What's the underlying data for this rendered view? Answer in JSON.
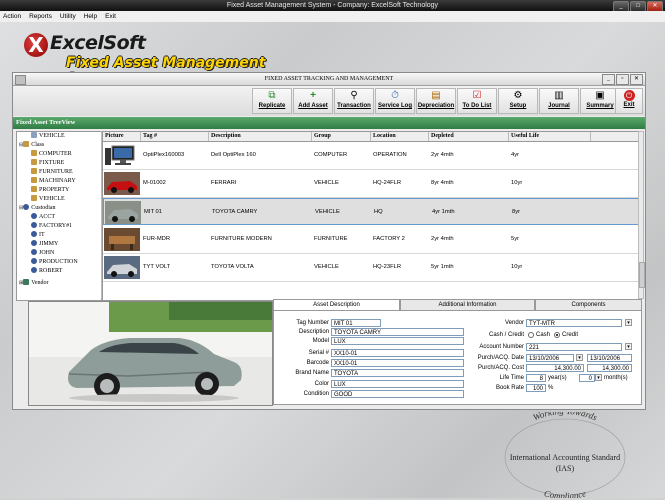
{
  "window_title": "Fixed Asset Management System - Company: ExcelSoft Technology",
  "menu": [
    "Action",
    "Reports",
    "Utility",
    "Help",
    "Exit"
  ],
  "logo": {
    "name": "ExcelSoft",
    "subtitle": "Fixed Asset Management System"
  },
  "main_window": {
    "title": "FIXED ASSET TRACKING AND MANAGEMENT"
  },
  "toolbar": [
    {
      "label": "Replicate",
      "icon": "replicate-icon"
    },
    {
      "label": "Add Asset",
      "icon": "add-asset-icon"
    },
    {
      "label": "Transaction",
      "icon": "transaction-icon"
    },
    {
      "label": "Service Log",
      "icon": "service-log-icon"
    },
    {
      "label": "Depreciation",
      "icon": "depreciation-icon"
    },
    {
      "label": "To Do List",
      "icon": "todo-list-icon"
    },
    {
      "label": "Setup",
      "icon": "setup-icon"
    },
    {
      "label": "Journal",
      "icon": "journal-icon"
    },
    {
      "label": "Summary",
      "icon": "summary-icon"
    },
    {
      "label": "Exit",
      "icon": "exit-icon"
    }
  ],
  "tree": {
    "title": "Fixed Asset TreeView",
    "items": [
      {
        "label": "VEHICLE",
        "level": 2
      },
      {
        "label": "Class",
        "level": 1
      },
      {
        "label": "COMPUTER",
        "level": 2
      },
      {
        "label": "FIXTURE",
        "level": 2
      },
      {
        "label": "FURNITURE",
        "level": 2
      },
      {
        "label": "MACHINARY",
        "level": 2
      },
      {
        "label": "PROPERTY",
        "level": 2
      },
      {
        "label": "VEHICLE",
        "level": 2
      },
      {
        "label": "Custodian",
        "level": 1
      },
      {
        "label": "ACCT",
        "level": 2
      },
      {
        "label": "FACTORY#1",
        "level": 2
      },
      {
        "label": "IT",
        "level": 2
      },
      {
        "label": "JIMMY",
        "level": 2
      },
      {
        "label": "JOHN",
        "level": 2
      },
      {
        "label": "PRODUCTION",
        "level": 2
      },
      {
        "label": "ROBERT",
        "level": 2
      },
      {
        "label": "Vendor",
        "level": 1
      }
    ]
  },
  "grid": {
    "columns": [
      "Picture",
      "Tag #",
      "Description",
      "Group",
      "Location",
      "Depleted",
      "Useful Life"
    ],
    "rows": [
      {
        "tag": "OptiPlex160003",
        "description": "Dell OptiPlex 160",
        "group": "COMPUTER",
        "location": "OPERATION",
        "depleted": "2yr 4mth",
        "useful_life": "4yr",
        "pic": "computer"
      },
      {
        "tag": "M-01002",
        "description": "FERRARI",
        "group": "VEHICLE",
        "location": "HQ-24FLR",
        "depleted": "8yr 4mth",
        "useful_life": "10yr",
        "pic": "redcar"
      },
      {
        "tag": "MIT 01",
        "description": "TOYOTA CAMRY",
        "group": "VEHICLE",
        "location": "HQ",
        "depleted": "4yr 1mth",
        "useful_life": "8yr",
        "pic": "graycar"
      },
      {
        "tag": "FUR-MDR",
        "description": "FURNITURE MODERN",
        "group": "FURNITURE",
        "location": "FACTORY 2",
        "depleted": "2yr 4mth",
        "useful_life": "5yr",
        "pic": "furniture"
      },
      {
        "tag": "TYT VOLT",
        "description": "TOYOTA VOLTA",
        "group": "VEHICLE",
        "location": "HQ-23FLR",
        "depleted": "5yr 1mth",
        "useful_life": "10yr",
        "pic": "silvercar"
      }
    ],
    "selected_row": 2
  },
  "tabs": [
    "Asset Description",
    "Additional Information",
    "Components"
  ],
  "active_tab": 0,
  "asset_description": {
    "tag_number_label": "Tag Number",
    "tag_number": "MIT 01",
    "description_label": "Description",
    "description": "TOYOTA CAMRY",
    "model_label": "Model",
    "model": "LUX",
    "serial_label": "Serial #",
    "serial": "XX10-01",
    "barcode_label": "Barcode",
    "barcode": "XX10-01",
    "brand_label": "Brand Name",
    "brand": "TOYOTA",
    "color_label": "Color",
    "color": "LUX",
    "condition_label": "Condition",
    "condition": "GOOD"
  },
  "purchase": {
    "vendor_label": "Vendor",
    "vendor": "TYT-MTR",
    "cash_credit_label": "Cash / Credit",
    "cash_label": "Cash",
    "credit_label": "Credit",
    "payment": "Credit",
    "account_label": "Account Number",
    "account": "221",
    "date_label": "Purch/ACQ. Date",
    "date_from": "13/10/2006",
    "date_to": "13/10/2006",
    "cost_label": "Purch/ACQ. Cost",
    "cost_1": "14,300.00",
    "cost_2": "14,300.00",
    "lifetime_label": "Life Time",
    "years": "8",
    "years_label": "year(s)",
    "months": "0",
    "months_label": "month(s)",
    "bookrate_label": "Book Rate",
    "book_rate": "100",
    "percent": "%"
  },
  "seal": {
    "top_text": "Working Towards",
    "main": "International Accounting Standard",
    "abbr": "(IAS)",
    "bottom_text": "Compliance"
  }
}
